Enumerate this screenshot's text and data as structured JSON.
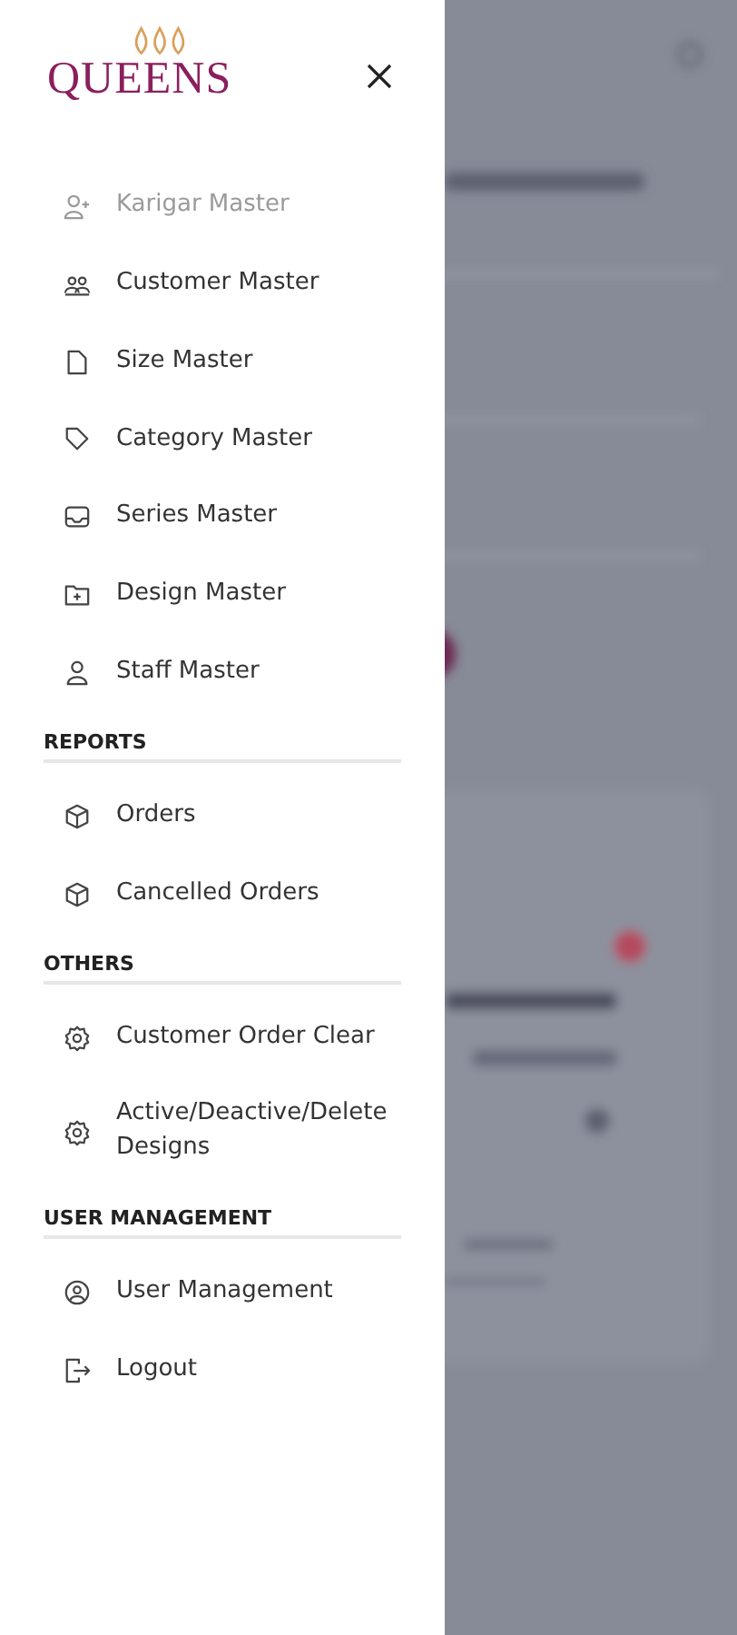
{
  "logo": {
    "name": "QUEENS"
  },
  "menu_groups": [
    {
      "items": [
        {
          "label": "Karigar Master",
          "disabled": true
        },
        {
          "label": "Customer Master",
          "disabled": false
        },
        {
          "label": "Size Master",
          "disabled": false
        },
        {
          "label": "Category Master",
          "disabled": false
        },
        {
          "label": "Series Master",
          "disabled": false
        },
        {
          "label": "Design Master",
          "disabled": false
        },
        {
          "label": "Staff Master",
          "disabled": false
        }
      ]
    },
    {
      "heading": "REPORTS",
      "items": [
        {
          "label": "Orders",
          "disabled": false
        },
        {
          "label": "Cancelled Orders",
          "disabled": false
        }
      ]
    },
    {
      "heading": "OTHERS",
      "items": [
        {
          "label": "Customer Order Clear",
          "disabled": false
        },
        {
          "label": "Active/Deactive/Delete Designs",
          "disabled": false
        }
      ]
    },
    {
      "heading": "USER MANAGEMENT",
      "items": [
        {
          "label": "User Management",
          "disabled": false
        },
        {
          "label": "Logout",
          "disabled": false
        }
      ]
    }
  ]
}
